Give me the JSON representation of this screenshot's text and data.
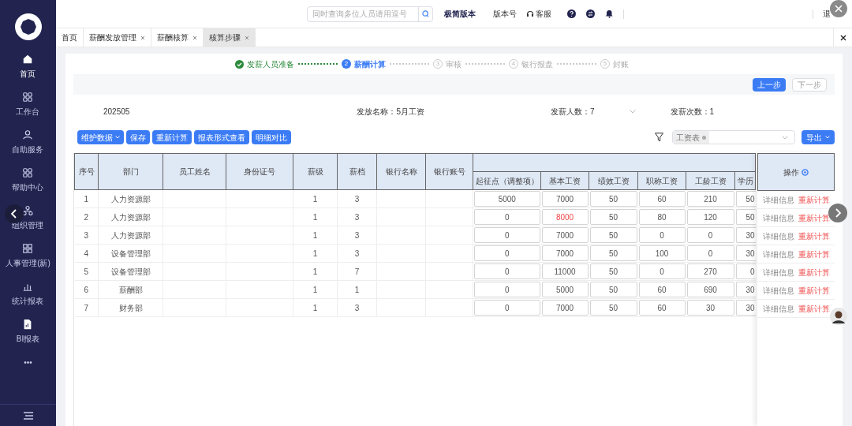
{
  "sidebar": {
    "items": [
      {
        "label": "首页",
        "selected": true
      },
      {
        "label": "工作台",
        "selected": false
      },
      {
        "label": "自助服务",
        "selected": false
      },
      {
        "label": "帮助中心",
        "selected": false
      },
      {
        "label": "组织管理",
        "selected": false
      },
      {
        "label": "人事管理(新)",
        "selected": false
      },
      {
        "label": "统计报表",
        "selected": false
      },
      {
        "label": "BI报表",
        "selected": false
      },
      {
        "label": "•••",
        "selected": false
      }
    ]
  },
  "header": {
    "search": {
      "placeholder": "同时查询多位人员请用逗号"
    },
    "edition": "极简版本",
    "version": "版本号",
    "service": "客服",
    "logout": "退"
  },
  "tabs": [
    {
      "label": "首页",
      "closable": false,
      "selected": false
    },
    {
      "label": "薪酬发放管理",
      "closable": true,
      "selected": false
    },
    {
      "label": "薪酬核算",
      "closable": true,
      "selected": false
    },
    {
      "label": "核算步骤",
      "closable": true,
      "selected": true
    }
  ],
  "steps": [
    {
      "label": "发薪人员准备",
      "completed": true,
      "active": false
    },
    {
      "number": "2",
      "label": "薪酬计算",
      "completed": false,
      "active": true
    },
    {
      "number": "3",
      "label": "审核",
      "completed": false,
      "active": false
    },
    {
      "number": "4",
      "label": "银行报盘",
      "completed": false,
      "active": false
    },
    {
      "number": "5",
      "label": "封账",
      "completed": false,
      "active": false
    }
  ],
  "nav_buttons": [
    {
      "label": "上一步",
      "primary": true
    },
    {
      "label": "下一步",
      "primary": false
    }
  ],
  "info": {
    "batch": "202505",
    "name": "发放名称：5月工资",
    "count": "发薪人数：7",
    "times": "发薪次数：1"
  },
  "toolbar": {
    "buttons": [
      {
        "label": "维护数据",
        "dropdown": true
      },
      {
        "label": "保存",
        "dropdown": false
      },
      {
        "label": "重新计算",
        "dropdown": false
      },
      {
        "label": "报表形式查看",
        "dropdown": false
      },
      {
        "label": "明细对比",
        "dropdown": false
      }
    ],
    "filter_tag": "工资表",
    "export": "导出"
  },
  "table": {
    "columns": [
      "序号",
      "部门",
      "员工姓名",
      "身份证号",
      "薪级",
      "薪档",
      "银行名称",
      "银行账号"
    ],
    "salary_columns": [
      "起征点（调整项）",
      "基本工资",
      "绩效工资",
      "职称工资",
      "工龄工资",
      "学历"
    ],
    "action_header": "操作",
    "rows": [
      {
        "index": "1",
        "dept": "人力资源部",
        "grade": "1",
        "step": "3",
        "values": [
          {
            "text": "5000",
            "changed": false
          },
          {
            "text": "7000",
            "changed": false
          },
          {
            "text": "50",
            "changed": false
          },
          {
            "text": "60",
            "changed": false
          },
          {
            "text": "210",
            "changed": false
          },
          {
            "text": "50",
            "changed": false
          }
        ],
        "actions": [
          "详细信息",
          "重新计算"
        ]
      },
      {
        "index": "2",
        "dept": "人力资源部",
        "grade": "1",
        "step": "3",
        "values": [
          {
            "text": "0",
            "changed": false
          },
          {
            "text": "8000",
            "changed": true
          },
          {
            "text": "50",
            "changed": false
          },
          {
            "text": "80",
            "changed": false
          },
          {
            "text": "120",
            "changed": false
          },
          {
            "text": "50",
            "changed": false
          }
        ],
        "actions": [
          "详细信息",
          "重新计算"
        ]
      },
      {
        "index": "3",
        "dept": "人力资源部",
        "grade": "1",
        "step": "3",
        "values": [
          {
            "text": "0",
            "changed": false
          },
          {
            "text": "7000",
            "changed": false
          },
          {
            "text": "50",
            "changed": false
          },
          {
            "text": "0",
            "changed": false
          },
          {
            "text": "0",
            "changed": false
          },
          {
            "text": "30",
            "changed": false
          }
        ],
        "actions": [
          "详细信息",
          "重新计算"
        ]
      },
      {
        "index": "4",
        "dept": "设备管理部",
        "grade": "1",
        "step": "3",
        "values": [
          {
            "text": "0",
            "changed": false
          },
          {
            "text": "7000",
            "changed": false
          },
          {
            "text": "50",
            "changed": false
          },
          {
            "text": "100",
            "changed": false
          },
          {
            "text": "0",
            "changed": false
          },
          {
            "text": "30",
            "changed": false
          }
        ],
        "actions": [
          "详细信息",
          "重新计算"
        ]
      },
      {
        "index": "5",
        "dept": "设备管理部",
        "grade": "1",
        "step": "7",
        "values": [
          {
            "text": "0",
            "changed": false
          },
          {
            "text": "11000",
            "changed": false
          },
          {
            "text": "50",
            "changed": false
          },
          {
            "text": "0",
            "changed": false
          },
          {
            "text": "270",
            "changed": false
          },
          {
            "text": "0",
            "changed": false
          }
        ],
        "actions": [
          "详细信息",
          "重新计算"
        ]
      },
      {
        "index": "6",
        "dept": "薪酬部",
        "grade": "1",
        "step": "1",
        "values": [
          {
            "text": "0",
            "changed": false
          },
          {
            "text": "5000",
            "changed": false
          },
          {
            "text": "50",
            "changed": false
          },
          {
            "text": "60",
            "changed": false
          },
          {
            "text": "690",
            "changed": false
          },
          {
            "text": "30",
            "changed": false
          }
        ],
        "actions": [
          "详细信息",
          "重新计算"
        ]
      },
      {
        "index": "7",
        "dept": "财务部",
        "grade": "1",
        "step": "3",
        "values": [
          {
            "text": "0",
            "changed": false
          },
          {
            "text": "7000",
            "changed": false
          },
          {
            "text": "50",
            "changed": false
          },
          {
            "text": "60",
            "changed": false
          },
          {
            "text": "30",
            "changed": false
          },
          {
            "text": "30",
            "changed": false
          }
        ],
        "actions": [
          "详细信息",
          "重新计算"
        ]
      }
    ]
  }
}
